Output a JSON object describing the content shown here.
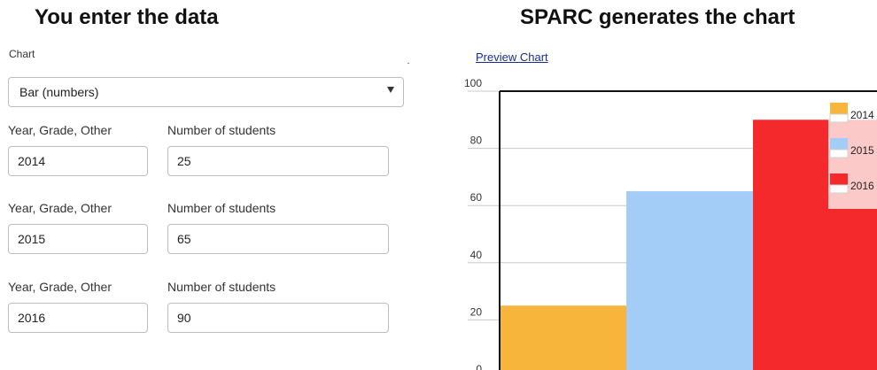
{
  "left_heading": "You enter the data",
  "right_heading": "SPARC generates the chart",
  "form": {
    "chart_label": "Chart",
    "chart_type": "Bar (numbers)",
    "rows": [
      {
        "category_label": "Year, Grade, Other",
        "value_label": "Number of students",
        "category": "2014",
        "value": "25"
      },
      {
        "category_label": "Year, Grade, Other",
        "value_label": "Number of students",
        "category": "2015",
        "value": "65"
      },
      {
        "category_label": "Year, Grade, Other",
        "value_label": "Number of students",
        "category": "2016",
        "value": "90"
      }
    ]
  },
  "preview_link": "Preview Chart",
  "chart_data": {
    "type": "bar",
    "categories": [
      "2014",
      "2015",
      "2016"
    ],
    "values": [
      25,
      65,
      90
    ],
    "colors": [
      "#f7b53b",
      "#a3ccf7",
      "#f3292b"
    ],
    "ylim": [
      0,
      100
    ],
    "yticks": [
      0,
      20,
      40,
      60,
      80,
      100
    ],
    "grid": true,
    "legend": [
      "2014",
      "2015",
      "2016"
    ],
    "legend_placement": "top-right"
  }
}
